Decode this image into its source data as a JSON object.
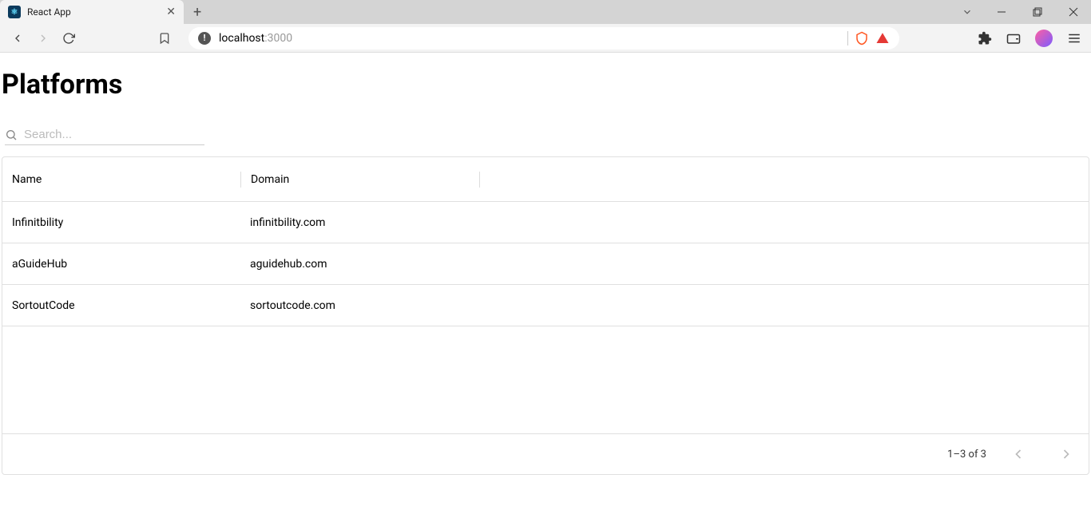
{
  "browser": {
    "tab_title": "React App",
    "url_host": "localhost",
    "url_port": ":3000"
  },
  "page": {
    "title": "Platforms",
    "search_placeholder": "Search..."
  },
  "table": {
    "headers": {
      "name": "Name",
      "domain": "Domain"
    },
    "rows": [
      {
        "name": "Infinitbility",
        "domain": "infinitbility.com"
      },
      {
        "name": "aGuideHub",
        "domain": "aguidehub.com"
      },
      {
        "name": "SortoutCode",
        "domain": "sortoutcode.com"
      }
    ],
    "pagination": "1–3 of 3"
  }
}
